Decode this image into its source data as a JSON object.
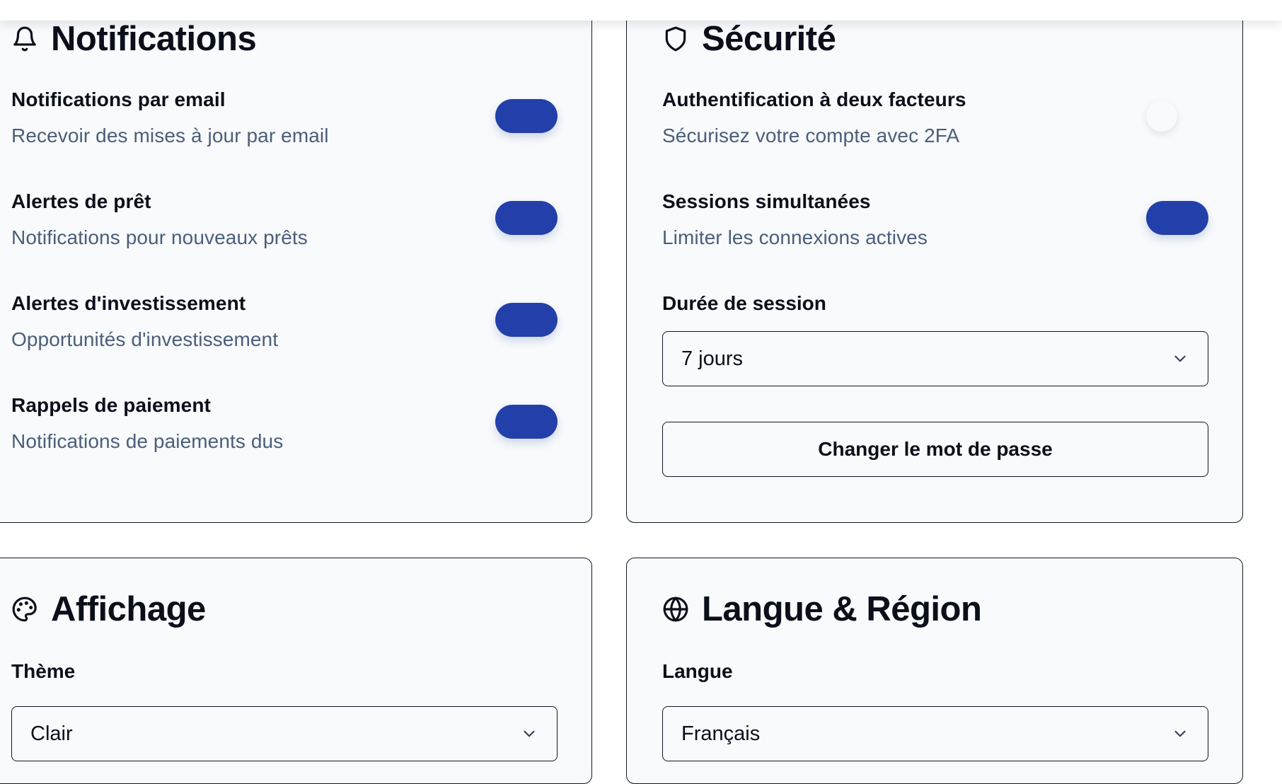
{
  "notifications": {
    "title": "Notifications",
    "icon": "bell-icon",
    "items": [
      {
        "title": "Notifications par email",
        "description": "Recevoir des mises à jour par email",
        "enabled": true
      },
      {
        "title": "Alertes de prêt",
        "description": "Notifications pour nouveaux prêts",
        "enabled": true
      },
      {
        "title": "Alertes d'investissement",
        "description": "Opportunités d'investissement",
        "enabled": true
      },
      {
        "title": "Rappels de paiement",
        "description": "Notifications de paiements dus",
        "enabled": true
      }
    ]
  },
  "security": {
    "title": "Sécurité",
    "icon": "shield-icon",
    "items": [
      {
        "title": "Authentification à deux facteurs",
        "description": "Sécurisez votre compte avec 2FA",
        "enabled": false
      },
      {
        "title": "Sessions simultanées",
        "description": "Limiter les connexions actives",
        "enabled": true
      }
    ],
    "session_label": "Durée de session",
    "session_value": "7 jours",
    "change_password_label": "Changer le mot de passe"
  },
  "display": {
    "title": "Affichage",
    "icon": "palette-icon",
    "theme_label": "Thème",
    "theme_value": "Clair"
  },
  "language": {
    "title": "Langue & Région",
    "icon": "globe-icon",
    "language_label": "Langue",
    "language_value": "Français"
  },
  "colors": {
    "toggle_on": "#2340aa",
    "card_background": "#f8fafc",
    "description_text": "#4b5e7a",
    "border": "#111827"
  }
}
